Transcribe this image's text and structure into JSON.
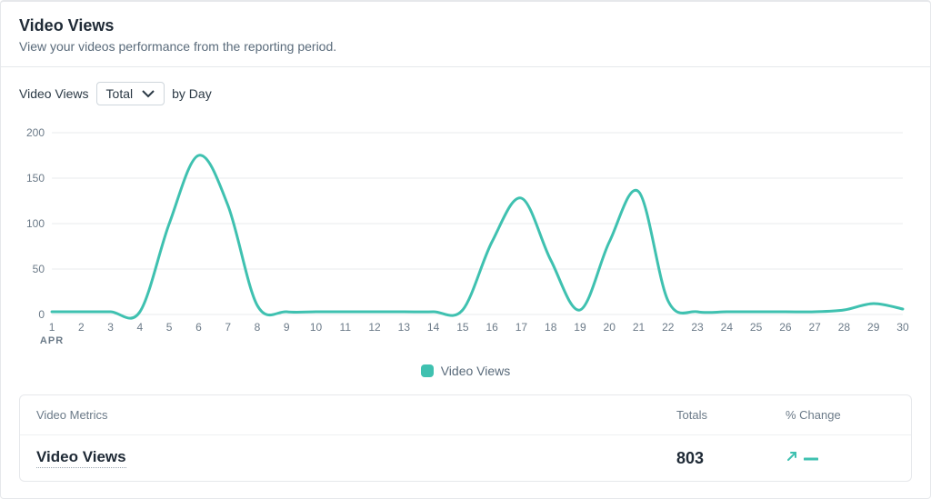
{
  "header": {
    "title": "Video Views",
    "subtitle": "View your videos performance from the reporting period."
  },
  "controls": {
    "metric_label": "Video Views",
    "dropdown_value": "Total",
    "suffix": "by Day"
  },
  "legend": {
    "series_label": "Video Views"
  },
  "metrics": {
    "col_metric": "Video Metrics",
    "col_totals": "Totals",
    "col_change": "% Change",
    "row_name": "Video Views",
    "row_total": "803"
  },
  "chart_data": {
    "type": "line",
    "title": "",
    "xlabel": "",
    "ylabel": "",
    "month": "APR",
    "ylim": [
      0,
      200
    ],
    "yticks": [
      0,
      50,
      100,
      150,
      200
    ],
    "categories": [
      1,
      2,
      3,
      4,
      5,
      6,
      7,
      8,
      9,
      10,
      11,
      12,
      13,
      14,
      15,
      16,
      17,
      18,
      19,
      20,
      21,
      22,
      23,
      24,
      25,
      26,
      27,
      28,
      29,
      30
    ],
    "series": [
      {
        "name": "Video Views",
        "values": [
          3,
          3,
          3,
          3,
          100,
          175,
          120,
          10,
          3,
          3,
          3,
          3,
          3,
          3,
          5,
          80,
          128,
          60,
          5,
          80,
          135,
          15,
          3,
          3,
          3,
          3,
          3,
          5,
          12,
          6
        ]
      }
    ],
    "color": "#3fc1b0"
  }
}
